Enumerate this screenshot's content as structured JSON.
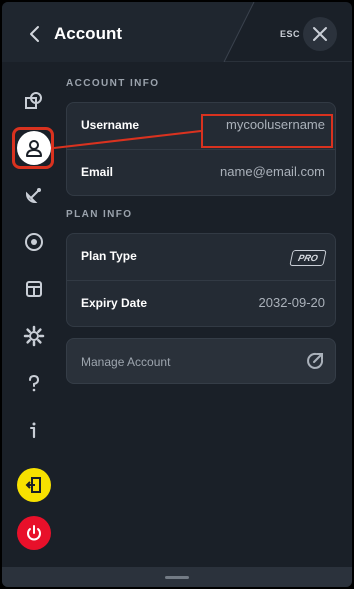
{
  "header": {
    "title": "Account",
    "esc_label": "ESC"
  },
  "sidebar": {
    "items": [
      {
        "icon": "shapes-icon"
      },
      {
        "icon": "user-icon",
        "selected": true
      },
      {
        "icon": "satellite-dish-icon"
      },
      {
        "icon": "target-icon"
      },
      {
        "icon": "package-icon"
      },
      {
        "icon": "gear-icon"
      },
      {
        "icon": "question-icon"
      },
      {
        "icon": "info-icon"
      },
      {
        "icon": "exit-icon"
      },
      {
        "icon": "power-icon"
      }
    ]
  },
  "account_info": {
    "section_label": "ACCOUNT INFO",
    "username_label": "Username",
    "username_value": "mycoolusername",
    "email_label": "Email",
    "email_value": "name@email.com"
  },
  "plan_info": {
    "section_label": "PLAN INFO",
    "plan_type_label": "Plan Type",
    "plan_type_badge": "PRO",
    "expiry_label": "Expiry Date",
    "expiry_value": "2032-09-20"
  },
  "manage": {
    "label": "Manage Account"
  },
  "colors": {
    "accent_yellow": "#f7e100",
    "accent_red": "#e8102a",
    "highlight": "#d9321f",
    "panel": "#1a2028",
    "card": "#242b34"
  }
}
